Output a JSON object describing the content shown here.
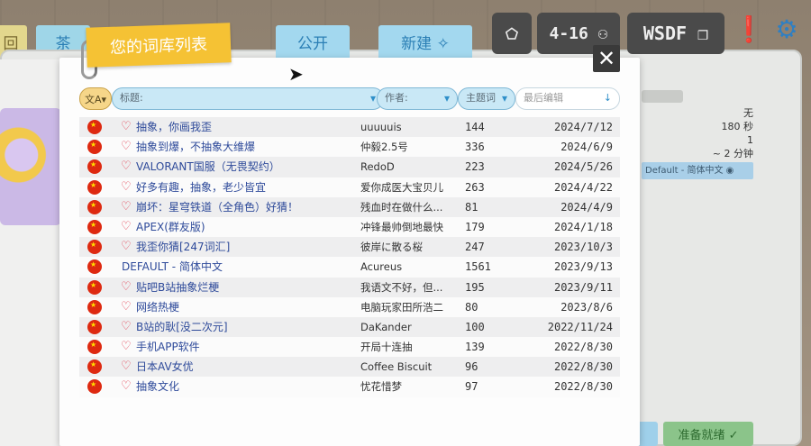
{
  "background": {
    "tab_left1": "回",
    "tab_left2": "茶",
    "tab_public": "公开",
    "tab_create": "新建 ✧",
    "level": "4-16 ⚇",
    "wsdf": "WSDF ❐",
    "right_info": [
      "无",
      "180 秒",
      "1",
      "~ 2 分钟"
    ],
    "lang_chip": "Default - 简体中文 ◉",
    "ready_button": "准备就绪 ✓"
  },
  "modal": {
    "title": "您的词库列表",
    "close": "✕"
  },
  "filters": {
    "translate": "文A▾",
    "title_placeholder": "标题:",
    "author_placeholder": "作者:",
    "words_label": "主题词",
    "edit_placeholder": "最后编辑"
  },
  "colors": {
    "accent_yellow": "#f5c234",
    "accent_blue": "#a3d8ef",
    "title_link": "#2e4a9a",
    "heart": "#e23d4f",
    "flag": "#de2910"
  },
  "rows": [
    {
      "heart": true,
      "title": "抽象，你画我歪",
      "author": "uuuuuis",
      "count": "144",
      "date": "2024/7/12"
    },
    {
      "heart": true,
      "title": "抽象到爆，不抽象大维爆",
      "author": "仲毅2.5号",
      "count": "336",
      "date": "2024/6/9"
    },
    {
      "heart": true,
      "title": "VALORANT国服（无畏契约）",
      "author": "RedoD",
      "count": "223",
      "date": "2024/5/26"
    },
    {
      "heart": true,
      "title": "好多有趣，抽象，老少皆宜",
      "author": "爱你成医大宝贝儿",
      "count": "263",
      "date": "2024/4/22"
    },
    {
      "heart": true,
      "title": "崩坏：星穹铁道（全角色）好猜！",
      "author": "残血时在做什么...",
      "count": "81",
      "date": "2024/4/9"
    },
    {
      "heart": true,
      "title": "APEX(群友版)",
      "author": "冲锋最帅倒地最快",
      "count": "179",
      "date": "2024/1/18"
    },
    {
      "heart": true,
      "title": "我歪你猜[247词汇]",
      "author": "彼岸に散る桜",
      "count": "247",
      "date": "2023/10/3"
    },
    {
      "heart": false,
      "title": "DEFAULT - 简体中文",
      "author": "Acureus",
      "count": "1561",
      "date": "2023/9/13"
    },
    {
      "heart": true,
      "title": "贴吧B站抽象烂梗",
      "author": "我语文不好，但...",
      "count": "195",
      "date": "2023/9/11"
    },
    {
      "heart": true,
      "title": "网络热梗",
      "author": "电脑玩家田所浩二",
      "count": "80",
      "date": "2023/8/6"
    },
    {
      "heart": true,
      "title": "B站的耿[没二次元]",
      "author": "DaKander",
      "count": "100",
      "date": "2022/11/24"
    },
    {
      "heart": true,
      "title": "手机APP软件",
      "author": "开局十连抽",
      "count": "139",
      "date": "2022/8/30"
    },
    {
      "heart": true,
      "title": "日本AV女优",
      "author": "Coffee Biscuit",
      "count": "96",
      "date": "2022/8/30"
    },
    {
      "heart": true,
      "title": "抽象文化",
      "author": "忧花惜梦",
      "count": "97",
      "date": "2022/8/30"
    }
  ]
}
